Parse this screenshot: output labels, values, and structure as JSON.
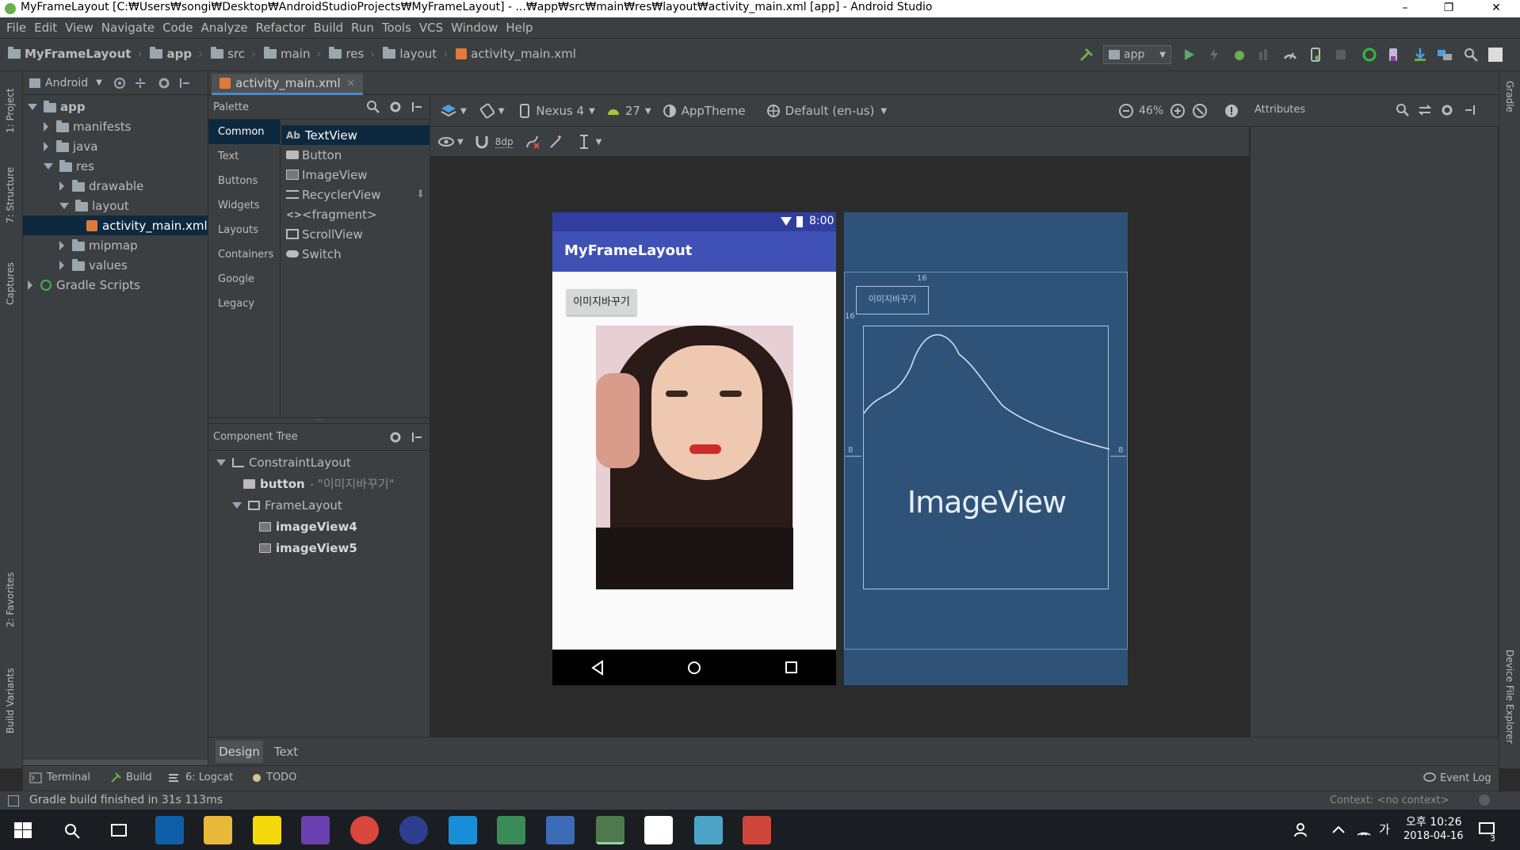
{
  "window": {
    "title": "MyFrameLayout [C:₩Users₩songi₩Desktop₩AndroidStudioProjects₩MyFrameLayout] - ...₩app₩src₩main₩res₩layout₩activity_main.xml [app] - Android Studio",
    "minimize": "–",
    "restore": "❐",
    "close": "✕"
  },
  "menu": [
    "File",
    "Edit",
    "View",
    "Navigate",
    "Code",
    "Analyze",
    "Refactor",
    "Build",
    "Run",
    "Tools",
    "VCS",
    "Window",
    "Help"
  ],
  "breadcrumbs": [
    "MyFrameLayout",
    "app",
    "src",
    "main",
    "res",
    "layout",
    "activity_main.xml"
  ],
  "run_config": "app",
  "project": {
    "view_mode": "Android",
    "tree": [
      {
        "label": "app",
        "level": 0,
        "arrow": "open",
        "bold": true
      },
      {
        "label": "manifests",
        "level": 1,
        "arrow": "closed"
      },
      {
        "label": "java",
        "level": 1,
        "arrow": "closed"
      },
      {
        "label": "res",
        "level": 1,
        "arrow": "open"
      },
      {
        "label": "drawable",
        "level": 2,
        "arrow": "closed"
      },
      {
        "label": "layout",
        "level": 2,
        "arrow": "open"
      },
      {
        "label": "activity_main.xml",
        "level": 3,
        "arrow": "none",
        "selected": true
      },
      {
        "label": "mipmap",
        "level": 2,
        "arrow": "closed"
      },
      {
        "label": "values",
        "level": 2,
        "arrow": "closed"
      },
      {
        "label": "Gradle Scripts",
        "level": 0,
        "arrow": "closed"
      }
    ]
  },
  "left_tool_tabs": [
    "1: Project",
    "7: Structure",
    "Captures",
    "2: Favorites",
    "Build Variants"
  ],
  "right_tool_tabs": [
    "Gradle",
    "Device File Explorer"
  ],
  "editor_tab": "activity_main.xml",
  "palette": {
    "title": "Palette",
    "categories": [
      "Common",
      "Text",
      "Buttons",
      "Widgets",
      "Layouts",
      "Containers",
      "Google",
      "Legacy"
    ],
    "selected_category": "Common",
    "items": [
      "TextView",
      "Button",
      "ImageView",
      "RecyclerView",
      "<fragment>",
      "ScrollView",
      "Switch"
    ],
    "selected_item": "TextView",
    "textview_glyph": "Ab"
  },
  "component_tree": {
    "title": "Component Tree",
    "rows": [
      {
        "label": "ConstraintLayout",
        "level": 0,
        "arrow": "open",
        "bold": false,
        "detail": ""
      },
      {
        "label": "button",
        "level": 1,
        "arrow": "none",
        "bold": true,
        "detail": "- \"이미지바꾸기\""
      },
      {
        "label": "FrameLayout",
        "level": 1,
        "arrow": "open",
        "bold": false,
        "detail": ""
      },
      {
        "label": "imageView4",
        "level": 2,
        "arrow": "none",
        "bold": true,
        "detail": ""
      },
      {
        "label": "imageView5",
        "level": 2,
        "arrow": "none",
        "bold": true,
        "detail": ""
      }
    ]
  },
  "design_toolbar": {
    "device": "Nexus 4",
    "api": "27",
    "theme": "AppTheme",
    "locale": "Default (en-us)",
    "zoom": "46%",
    "margin": "8dp"
  },
  "preview": {
    "time": "8:00",
    "app_title": "MyFrameLayout",
    "button_label": "이미지바꾸기",
    "accent": "#3f51b5"
  },
  "blueprint": {
    "button_label": "이미지바꾸기",
    "image_label": "ImageView",
    "margin_top": "16",
    "margin_left": "16",
    "margin_side_left": "8",
    "margin_side_right": "8"
  },
  "attributes": {
    "title": "Attributes"
  },
  "bottom_tabs": [
    "Design",
    "Text"
  ],
  "tool_windows": [
    {
      "label": "Terminal"
    },
    {
      "label": "Build"
    },
    {
      "label": "6: Logcat"
    },
    {
      "label": "TODO"
    }
  ],
  "event_log": "Event Log",
  "status": {
    "message": "Gradle build finished in 31s 113ms",
    "context": "Context: <no context>"
  },
  "taskbar": {
    "time": "오후 10:26",
    "date": "2018-04-16",
    "ime": "가",
    "notifications": "3"
  }
}
